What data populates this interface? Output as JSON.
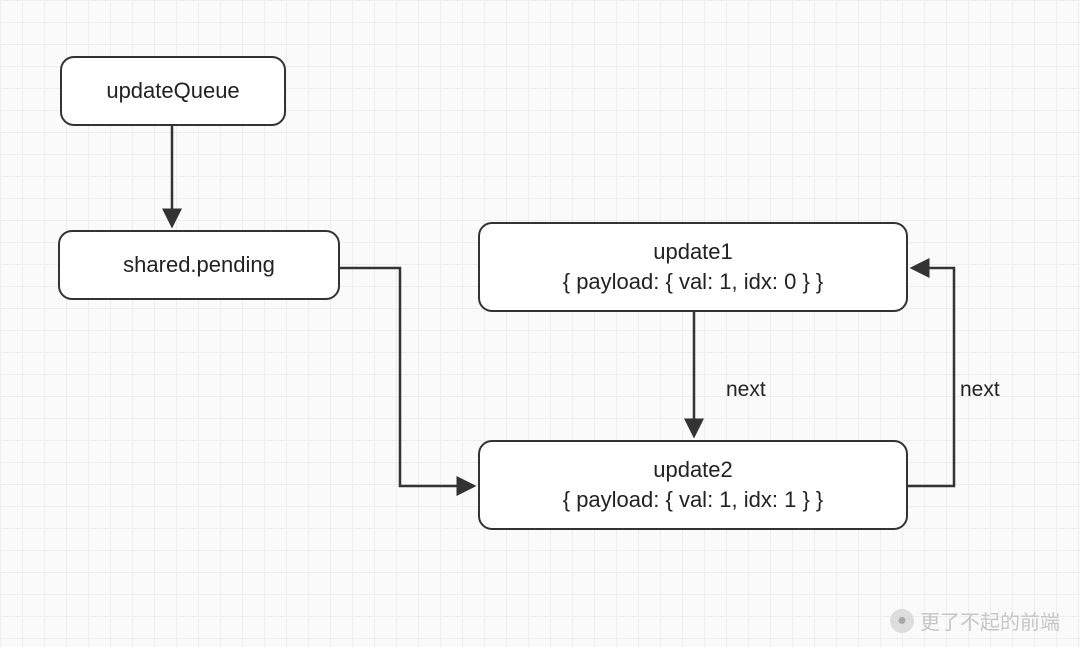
{
  "diagram": {
    "nodes": {
      "updateQueue": {
        "label": "updateQueue"
      },
      "sharedPending": {
        "label": "shared.pending"
      },
      "update1": {
        "title": "update1",
        "detail": "{ payload: { val: 1, idx: 0 } }"
      },
      "update2": {
        "title": "update2",
        "detail": "{ payload: { val: 1, idx: 1 } }"
      }
    },
    "edges": {
      "u1_to_u2": {
        "label": "next"
      },
      "u2_to_u1": {
        "label": "next"
      }
    }
  },
  "watermark": {
    "text": "更了不起的前端"
  }
}
